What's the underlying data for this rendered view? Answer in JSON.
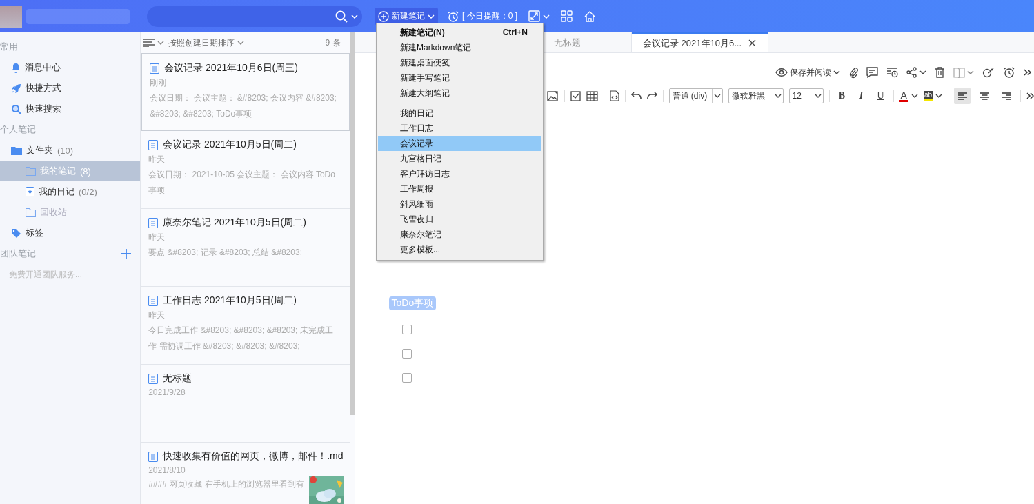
{
  "top_bar": {
    "new_note_button": {
      "label": "新建笔记",
      "open": true
    },
    "reminder": "[ 今日提醒：0 ]"
  },
  "sidebar": {
    "sections": [
      {
        "title": "常用",
        "items": [
          {
            "label": "消息中心",
            "kind": "bell"
          },
          {
            "label": "快捷方式",
            "kind": "rocket"
          },
          {
            "label": "快速搜索",
            "kind": "search"
          }
        ]
      },
      {
        "title": "个人笔记",
        "items": [
          {
            "label": "文件夹",
            "count": "(10)",
            "kind": "folder",
            "children": [
              {
                "label": "我的笔记",
                "count": "(8)",
                "kind": "folder",
                "selected": true,
                "dimmed": false
              },
              {
                "label": "我的日记",
                "count": "(0/2)",
                "kind": "diary",
                "selected": false,
                "dimmed": false
              },
              {
                "label": "回收站",
                "kind": "folder",
                "selected": false,
                "dimmed": true
              }
            ]
          },
          {
            "label": "标签",
            "kind": "tag"
          }
        ]
      },
      {
        "title": "团队笔记",
        "add_button": true,
        "hint": "免费开通团队服务..."
      }
    ]
  },
  "note_list": {
    "sort_label": "按照创建日期排序",
    "count": "9 条",
    "notes": [
      {
        "title": "会议记录 2021年10月6日(周三)",
        "time": "刚刚",
        "snippet": "会议日期：  会议主题：  &#8203; 会议内容 &#8203; &#8203; &#8203; ToDo事项",
        "selected": true
      },
      {
        "title": "会议记录 2021年10月5日(周二)",
        "time": "昨天",
        "snippet": "会议日期：  2021-10-05 会议主题：   会议内容 ToDo 事项",
        "selected": false
      },
      {
        "title": "康奈尔笔记 2021年10月5日(周二)",
        "time": "昨天",
        "snippet": "要点 &#8203; 记录 &#8203; 总结 &#8203;",
        "selected": false
      },
      {
        "title": "工作日志 2021年10月5日(周二)",
        "time": "昨天",
        "snippet": "今日完成工作 &#8203; &#8203; &#8203; 未完成工作 需协调工作 &#8203; &#8203; &#8203;",
        "selected": false
      },
      {
        "title": "无标题",
        "time": "2021/9/28",
        "selected": false
      },
      {
        "title": "快速收集有价值的网页，微博，邮件！.md",
        "time": "2021/8/10",
        "snippet": " #### 网页收藏 在手机上的浏览器里看到有",
        "selected": false
      }
    ]
  },
  "tabs": [
    {
      "label": "无标题",
      "selected": false
    },
    {
      "label": "会议记录 2021年10月6...",
      "selected": true
    }
  ],
  "editor_toolbar": {
    "save_read_label": "保存并阅读",
    "selects": [
      "普通 (div)",
      "微软雅黑",
      "12"
    ],
    "format_buttons": [
      "B",
      "I",
      "U"
    ],
    "font_color": {
      "label": "A"
    },
    "highlight": {
      "label": "ab"
    },
    "align": [
      {
        "kind": "left",
        "selected": true
      },
      {
        "kind": "center",
        "selected": false
      },
      {
        "kind": "right",
        "selected": false
      }
    ]
  },
  "editor": {
    "tag": "ToDo事项",
    "todos": [
      {
        "checked": false
      },
      {
        "checked": false
      },
      {
        "checked": false
      }
    ]
  },
  "menu": {
    "items": [
      {
        "kind": "item",
        "label": "新建笔记(N)",
        "shortcut": "Ctrl+N",
        "default": true,
        "selected": false
      },
      {
        "kind": "item",
        "label": "新建Markdown笔记",
        "default": false,
        "selected": false
      },
      {
        "kind": "item",
        "label": "新建桌面便笺",
        "default": false,
        "selected": false
      },
      {
        "kind": "item",
        "label": "新建手写笔记",
        "default": false,
        "selected": false
      },
      {
        "kind": "item",
        "label": "新建大纲笔记",
        "default": false,
        "selected": false
      },
      {
        "kind": "separator"
      },
      {
        "kind": "item",
        "label": "我的日记",
        "default": false,
        "selected": false
      },
      {
        "kind": "item",
        "label": "工作日志",
        "default": false,
        "selected": false
      },
      {
        "kind": "item",
        "label": "会议记录",
        "default": false,
        "selected": true
      },
      {
        "kind": "item",
        "label": "九宫格日记",
        "default": false,
        "selected": false
      },
      {
        "kind": "item",
        "label": "客户拜访日志",
        "default": false,
        "selected": false
      },
      {
        "kind": "item",
        "label": "工作周报",
        "default": false,
        "selected": false
      },
      {
        "kind": "item",
        "label": "斜风细雨",
        "default": false,
        "selected": false
      },
      {
        "kind": "item",
        "label": "飞雪夜归",
        "default": false,
        "selected": false
      },
      {
        "kind": "item",
        "label": "康奈尔笔记",
        "default": false,
        "selected": false
      },
      {
        "kind": "item",
        "label": "更多模板...",
        "default": false,
        "selected": false
      }
    ]
  }
}
